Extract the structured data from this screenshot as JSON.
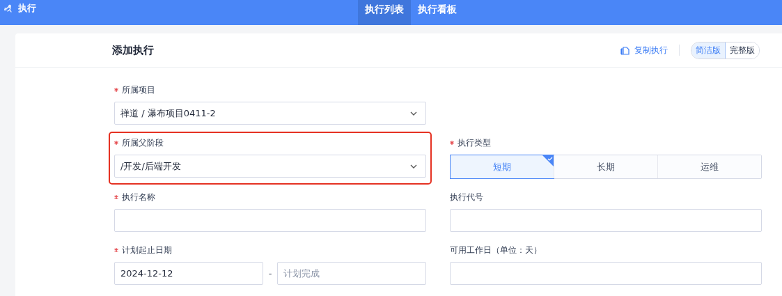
{
  "topbar": {
    "app": "执行",
    "tabs": [
      {
        "label": "执行列表",
        "selected": true
      },
      {
        "label": "执行看板",
        "selected": false
      }
    ]
  },
  "header": {
    "title": "添加执行",
    "copy_action": "复制执行",
    "modes": [
      {
        "label": "简洁版",
        "selected": true
      },
      {
        "label": "完整版",
        "selected": false
      }
    ]
  },
  "rows": [
    [
      {
        "kind": "select",
        "label": "所属项目",
        "required": true,
        "highlighted": false,
        "value": "禅道 / 瀑布项目0411-2"
      }
    ],
    [
      {
        "kind": "select",
        "label": "所属父阶段",
        "required": true,
        "highlighted": true,
        "value": "/开发/后端开发"
      },
      {
        "kind": "segmented",
        "label": "执行类型",
        "required": true,
        "highlighted": false,
        "options": [
          {
            "label": "短期",
            "selected": true
          },
          {
            "label": "长期",
            "selected": false
          },
          {
            "label": "运维",
            "selected": false
          }
        ]
      }
    ],
    [
      {
        "kind": "input",
        "label": "执行名称",
        "required": true,
        "highlighted": false
      },
      {
        "kind": "input",
        "label": "执行代号",
        "required": false,
        "highlighted": false
      }
    ],
    [
      {
        "kind": "daterange",
        "label": "计划起止日期",
        "required": true,
        "highlighted": false,
        "value": "2024-12-12",
        "separator": "-",
        "placeholder": "计划完成"
      },
      {
        "kind": "input",
        "label": "可用工作日（单位：天）",
        "required": false,
        "highlighted": false
      }
    ]
  ]
}
